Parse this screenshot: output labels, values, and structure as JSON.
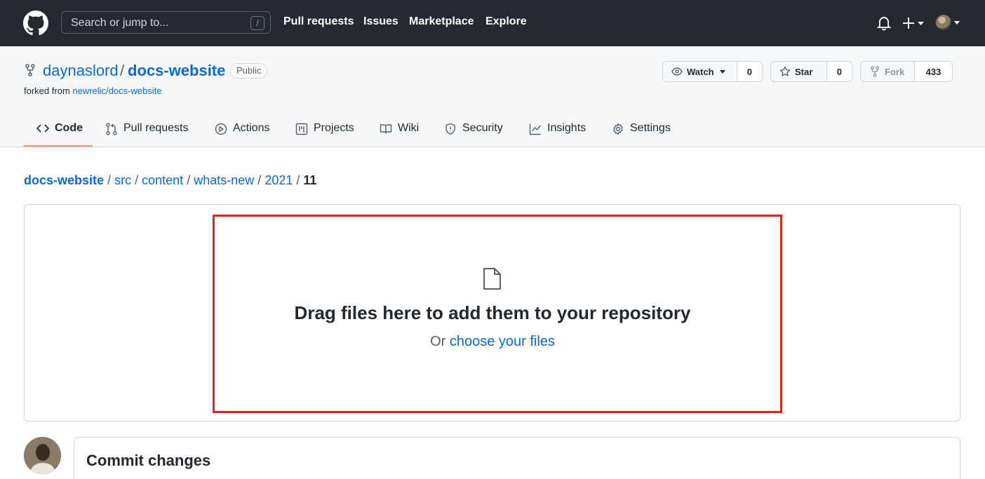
{
  "header": {
    "search_placeholder": "Search or jump to...",
    "search_shortcut": "/",
    "nav": [
      "Pull requests",
      "Issues",
      "Marketplace",
      "Explore"
    ]
  },
  "repo": {
    "owner": "daynaslord",
    "separator": "/",
    "name": "docs-website",
    "visibility": "Public",
    "forked_from_prefix": "forked from",
    "forked_from_link": "newrelic/docs-website",
    "watch_label": "Watch",
    "watch_count": "0",
    "star_label": "Star",
    "star_count": "0",
    "fork_label": "Fork",
    "fork_count": "433"
  },
  "tabs": [
    {
      "label": "Code",
      "icon": "code-icon",
      "selected": true
    },
    {
      "label": "Pull requests",
      "icon": "pull-request-icon"
    },
    {
      "label": "Actions",
      "icon": "play-icon"
    },
    {
      "label": "Projects",
      "icon": "project-icon"
    },
    {
      "label": "Wiki",
      "icon": "book-icon"
    },
    {
      "label": "Security",
      "icon": "shield-icon"
    },
    {
      "label": "Insights",
      "icon": "graph-icon"
    },
    {
      "label": "Settings",
      "icon": "gear-icon"
    }
  ],
  "breadcrumb": {
    "parts": [
      "docs-website",
      "src",
      "content",
      "whats-new",
      "2021"
    ],
    "current": "11",
    "separator": "/"
  },
  "upload": {
    "heading": "Drag files here to add them to your repository",
    "or_text": "Or",
    "choose_link": "choose your files"
  },
  "commit": {
    "title": "Commit changes"
  },
  "colors": {
    "header_bg": "#24292f",
    "link": "#0969da",
    "highlight": "#e8221b",
    "tab_underline": "#fd8c73"
  }
}
